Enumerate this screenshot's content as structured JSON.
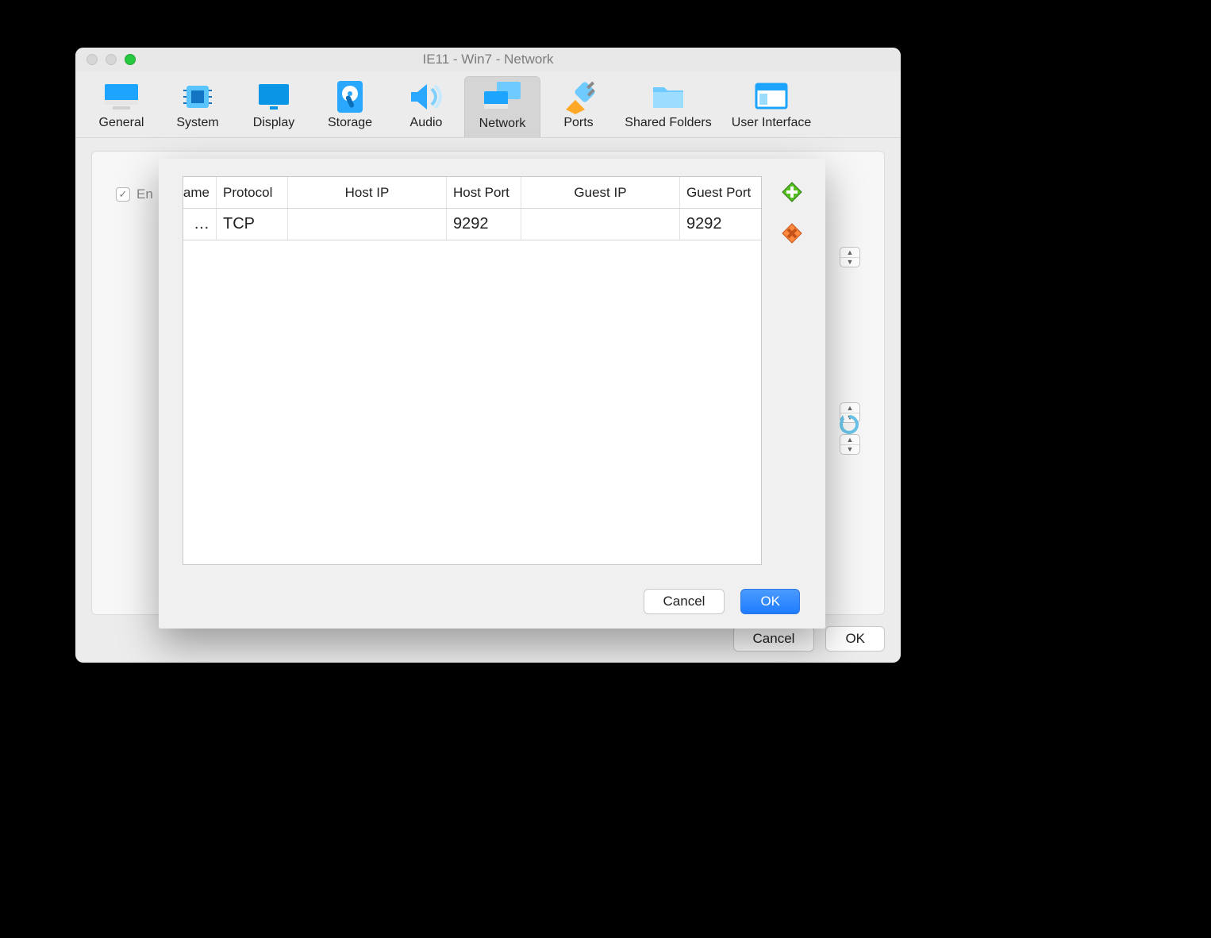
{
  "window": {
    "title": "IE11 - Win7 - Network"
  },
  "toolbar": {
    "items": [
      {
        "label": "General"
      },
      {
        "label": "System"
      },
      {
        "label": "Display"
      },
      {
        "label": "Storage"
      },
      {
        "label": "Audio"
      },
      {
        "label": "Network"
      },
      {
        "label": "Ports"
      },
      {
        "label": "Shared Folders"
      },
      {
        "label": "User Interface"
      }
    ]
  },
  "panel": {
    "enable_prefix": "En"
  },
  "bottom": {
    "cancel": "Cancel",
    "ok": "OK"
  },
  "modal": {
    "headers": {
      "name": "lame",
      "protocol": "Protocol",
      "host_ip": "Host IP",
      "host_port": "Host Port",
      "guest_ip": "Guest IP",
      "guest_port": "Guest Port"
    },
    "row": {
      "name": "…",
      "protocol": "TCP",
      "host_ip": "",
      "host_port": "9292",
      "guest_ip": "",
      "guest_port": "9292"
    },
    "buttons": {
      "cancel": "Cancel",
      "ok": "OK"
    }
  }
}
